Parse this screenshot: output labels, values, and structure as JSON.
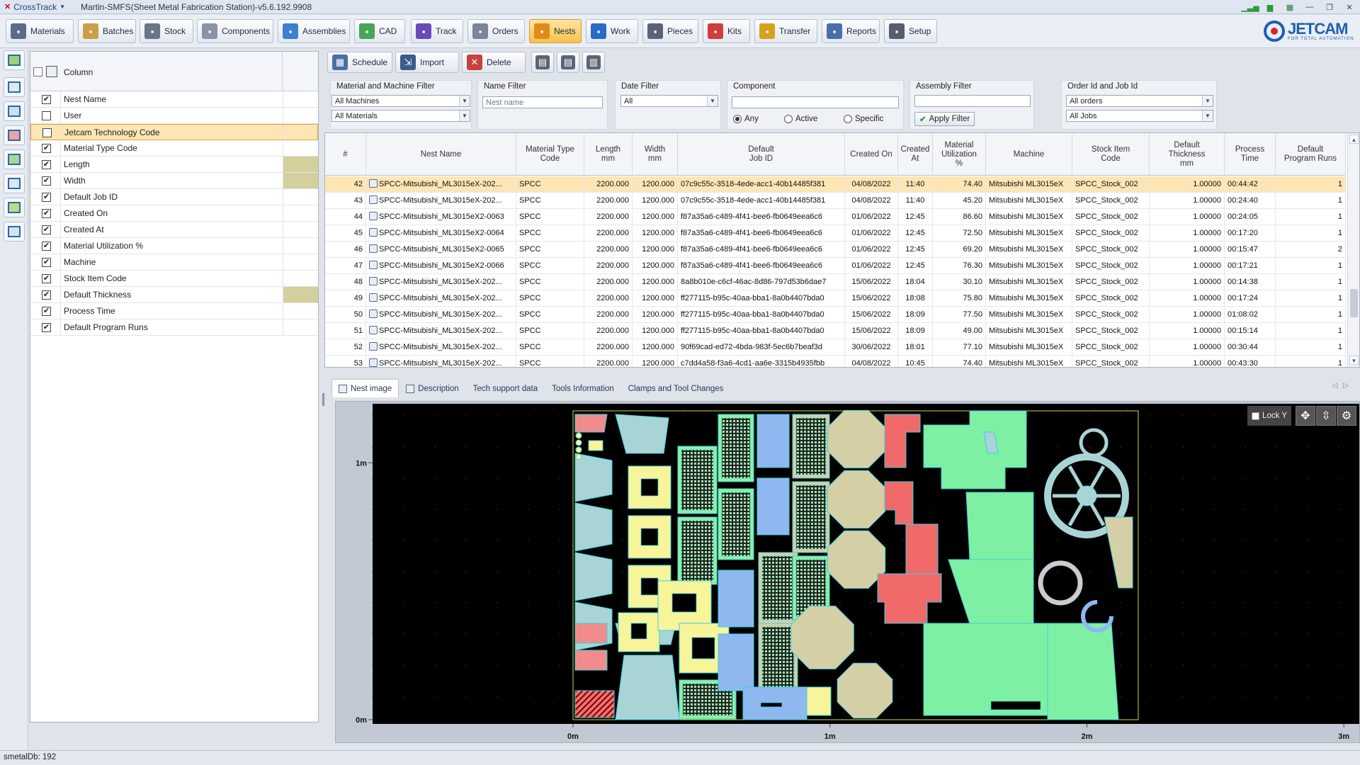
{
  "titlebar": {
    "app_menu": "CrossTrack",
    "window_title": "Martin-SMFS(Sheet Metal Fabrication Station)-v5.6.192.9908"
  },
  "toolbar": {
    "buttons": [
      {
        "label": "Materials",
        "icon": "materials-icon",
        "color": "#5a6c8a"
      },
      {
        "label": "Batches",
        "icon": "batches-icon",
        "color": "#c9a04a"
      },
      {
        "label": "Stock",
        "icon": "stock-icon",
        "color": "#6b7588"
      },
      {
        "label": "Components",
        "icon": "components-icon",
        "color": "#8a94a8"
      },
      {
        "label": "Assemblies",
        "icon": "assemblies-icon",
        "color": "#3d7fd0"
      },
      {
        "label": "CAD",
        "icon": "cad-icon",
        "color": "#4aa35a"
      },
      {
        "label": "Track",
        "icon": "track-icon",
        "color": "#6a4ab8"
      },
      {
        "label": "Orders",
        "icon": "orders-icon",
        "color": "#7a8599"
      },
      {
        "label": "Nests",
        "icon": "nests-icon",
        "color": "#e08c1a"
      },
      {
        "label": "Work",
        "icon": "work-icon",
        "color": "#2a6ac8"
      },
      {
        "label": "Pieces",
        "icon": "pieces-icon",
        "color": "#5a6478"
      },
      {
        "label": "Kits",
        "icon": "kits-icon",
        "color": "#d13c3c"
      },
      {
        "label": "Transfer",
        "icon": "transfer-icon",
        "color": "#d4a21e"
      },
      {
        "label": "Reports",
        "icon": "reports-icon",
        "color": "#4a6fa8"
      },
      {
        "label": "Setup",
        "icon": "setup-icon",
        "color": "#555e70"
      }
    ],
    "active": "Nests"
  },
  "logo": {
    "text": "JETCAM",
    "tagline": "FOR TOTAL AUTOMATION"
  },
  "column_panel": {
    "header": "Column",
    "rows": [
      {
        "label": "Nest Name",
        "checked": true,
        "fill": false
      },
      {
        "label": "User",
        "checked": false,
        "fill": false
      },
      {
        "label": "Jetcam Technology Code",
        "checked": false,
        "fill": false,
        "selected": true
      },
      {
        "label": "Material Type Code",
        "checked": true,
        "fill": false
      },
      {
        "label": "Length",
        "checked": true,
        "fill": true
      },
      {
        "label": "Width",
        "checked": true,
        "fill": true
      },
      {
        "label": "Default Job ID",
        "checked": true,
        "fill": false
      },
      {
        "label": "Created On",
        "checked": true,
        "fill": false
      },
      {
        "label": "Created At",
        "checked": true,
        "fill": false
      },
      {
        "label": "Material Utilization %",
        "checked": true,
        "fill": false
      },
      {
        "label": "Machine",
        "checked": true,
        "fill": false
      },
      {
        "label": "Stock Item Code",
        "checked": true,
        "fill": false
      },
      {
        "label": "Default Thickness",
        "checked": true,
        "fill": true
      },
      {
        "label": "Process Time",
        "checked": true,
        "fill": false
      },
      {
        "label": "Default Program Runs",
        "checked": true,
        "fill": false
      }
    ]
  },
  "actions": {
    "schedule": "Schedule",
    "import": "Import",
    "delete": "Delete"
  },
  "filters": {
    "material_machine": {
      "title": "Material and Machine Filter",
      "machine": "All Machines",
      "material": "All Materials"
    },
    "name": {
      "title": "Name Filter",
      "placeholder": "Nest name"
    },
    "date": {
      "title": "Date Filter",
      "value": "All"
    },
    "component": {
      "title": "Component",
      "radios": [
        "Any",
        "Active",
        "Specific"
      ],
      "selected": "Any"
    },
    "assembly": {
      "title": "Assembly Filter",
      "apply": "Apply Filter"
    },
    "order_job": {
      "title": "Order Id and Job Id",
      "order": "All orders",
      "job": "All Jobs"
    }
  },
  "grid": {
    "columns": [
      "#",
      "Nest Name",
      "Material Type\nCode",
      "Length\nmm",
      "Width\nmm",
      "Default\nJob ID",
      "Created On",
      "Created\nAt",
      "Material\nUtilization\n%",
      "Machine",
      "Stock Item\nCode",
      "Default\nThickness\nmm",
      "Process\nTime",
      "Default\nProgram Runs"
    ],
    "rows": [
      [
        "42",
        "SPCC-Mitsubishi_ML3015eX-202...",
        "SPCC",
        "2200.000",
        "1200.000",
        "07c9c55c-3518-4ede-acc1-40b14485f381",
        "04/08/2022",
        "11:40",
        "74.40",
        "Mitsubishi ML3015eX",
        "SPCC_Stock_002",
        "1.00000",
        "00:44:42",
        "1"
      ],
      [
        "43",
        "SPCC-Mitsubishi_ML3015eX-202...",
        "SPCC",
        "2200.000",
        "1200.000",
        "07c9c55c-3518-4ede-acc1-40b14485f381",
        "04/08/2022",
        "11:40",
        "45.20",
        "Mitsubishi ML3015eX",
        "SPCC_Stock_002",
        "1.00000",
        "00:24:40",
        "1"
      ],
      [
        "44",
        "SPCC-Mitsubishi_ML3015eX2-0063",
        "SPCC",
        "2200.000",
        "1200.000",
        "f87a35a6-c489-4f41-bee6-fb0649eea6c6",
        "01/06/2022",
        "12:45",
        "86.60",
        "Mitsubishi ML3015eX",
        "SPCC_Stock_002",
        "1.00000",
        "00:24:05",
        "1"
      ],
      [
        "45",
        "SPCC-Mitsubishi_ML3015eX2-0064",
        "SPCC",
        "2200.000",
        "1200.000",
        "f87a35a6-c489-4f41-bee6-fb0649eea6c6",
        "01/06/2022",
        "12:45",
        "72.50",
        "Mitsubishi ML3015eX",
        "SPCC_Stock_002",
        "1.00000",
        "00:17:20",
        "1"
      ],
      [
        "46",
        "SPCC-Mitsubishi_ML3015eX2-0065",
        "SPCC",
        "2200.000",
        "1200.000",
        "f87a35a6-c489-4f41-bee6-fb0649eea6c6",
        "01/06/2022",
        "12:45",
        "69.20",
        "Mitsubishi ML3015eX",
        "SPCC_Stock_002",
        "1.00000",
        "00:15:47",
        "2"
      ],
      [
        "47",
        "SPCC-Mitsubishi_ML3015eX2-0066",
        "SPCC",
        "2200.000",
        "1200.000",
        "f87a35a6-c489-4f41-bee6-fb0649eea6c6",
        "01/06/2022",
        "12:45",
        "76.30",
        "Mitsubishi ML3015eX",
        "SPCC_Stock_002",
        "1.00000",
        "00:17:21",
        "1"
      ],
      [
        "48",
        "SPCC-Mitsubishi_ML3015eX-202...",
        "SPCC",
        "2200.000",
        "1200.000",
        "8a8b010e-c6cf-46ac-8d86-797d53b6dae7",
        "15/06/2022",
        "18:04",
        "30.10",
        "Mitsubishi ML3015eX",
        "SPCC_Stock_002",
        "1.00000",
        "00:14:38",
        "1"
      ],
      [
        "49",
        "SPCC-Mitsubishi_ML3015eX-202...",
        "SPCC",
        "2200.000",
        "1200.000",
        "ff277115-b95c-40aa-bba1-8a0b4407bda0",
        "15/06/2022",
        "18:08",
        "75.80",
        "Mitsubishi ML3015eX",
        "SPCC_Stock_002",
        "1.00000",
        "00:17:24",
        "1"
      ],
      [
        "50",
        "SPCC-Mitsubishi_ML3015eX-202...",
        "SPCC",
        "2200.000",
        "1200.000",
        "ff277115-b95c-40aa-bba1-8a0b4407bda0",
        "15/06/2022",
        "18:09",
        "77.50",
        "Mitsubishi ML3015eX",
        "SPCC_Stock_002",
        "1.00000",
        "01:08:02",
        "1"
      ],
      [
        "51",
        "SPCC-Mitsubishi_ML3015eX-202...",
        "SPCC",
        "2200.000",
        "1200.000",
        "ff277115-b95c-40aa-bba1-8a0b4407bda0",
        "15/06/2022",
        "18:09",
        "49.00",
        "Mitsubishi ML3015eX",
        "SPCC_Stock_002",
        "1.00000",
        "00:15:14",
        "1"
      ],
      [
        "52",
        "SPCC-Mitsubishi_ML3015eX-202...",
        "SPCC",
        "2200.000",
        "1200.000",
        "90f69cad-ed72-4bda-983f-5ec6b7beaf3d",
        "30/06/2022",
        "18:01",
        "77.10",
        "Mitsubishi ML3015eX",
        "SPCC_Stock_002",
        "1.00000",
        "00:30:44",
        "1"
      ],
      [
        "53",
        "SPCC-Mitsubishi_ML3015eX-202...",
        "SPCC",
        "2200.000",
        "1200.000",
        "c7dd4a58-f3a6-4cd1-aa6e-3315b4935fbb",
        "04/08/2022",
        "10:45",
        "74.40",
        "Mitsubishi ML3015eX",
        "SPCC_Stock_002",
        "1.00000",
        "00:43:30",
        "1"
      ]
    ],
    "highlighted_row": 0
  },
  "tabs": [
    "Nest image",
    "Description",
    "Tech support data",
    "Tools Information",
    "Clamps and Tool Changes"
  ],
  "active_tab": "Nest image",
  "viewer": {
    "lock_label": "Lock Y",
    "x_ticks": [
      "0m",
      "1m",
      "2m",
      "3m"
    ],
    "y_ticks": [
      "1m",
      "0m"
    ]
  },
  "status": {
    "text": "smetalDb: 192"
  }
}
